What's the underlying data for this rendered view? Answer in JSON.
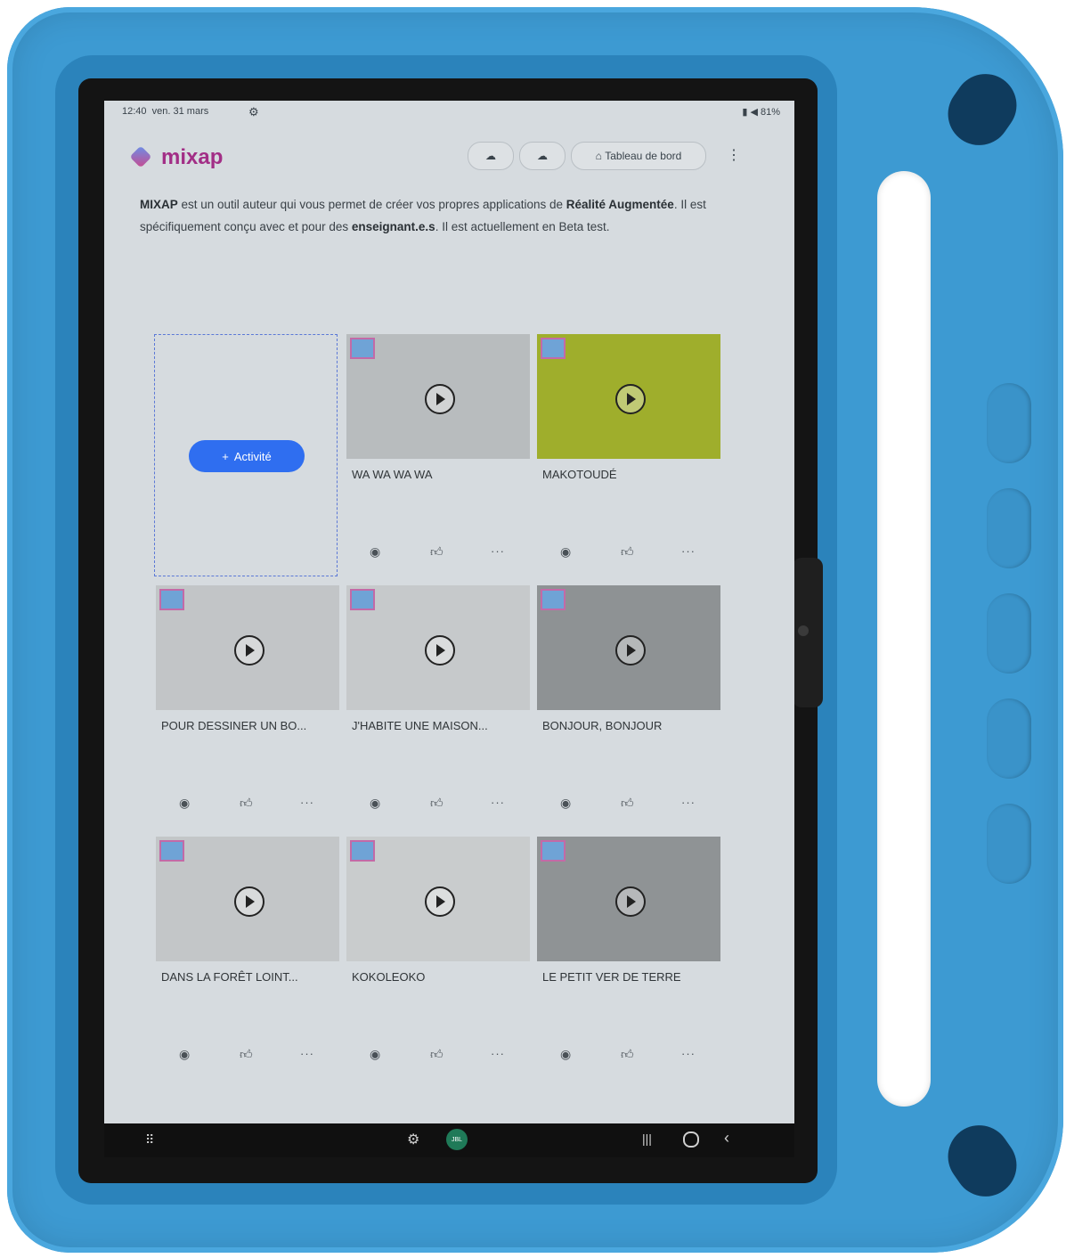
{
  "status": {
    "time": "12:40",
    "date": "ven. 31 mars",
    "battery": "81%"
  },
  "app": {
    "brand": "mixap",
    "dashboard_label": "Tableau de bord"
  },
  "intro": {
    "p1": "MIXAP",
    "p2": " est un outil auteur qui vous permet de créer vos propres applications de ",
    "p3": "Réalité Augmentée",
    "p4": ". Il est spécifiquement conçu avec et pour des ",
    "p5": "enseignant.e.s",
    "p6": ". Il est actuellement en Beta test."
  },
  "add_activity_label": "Activité",
  "activities": [
    {
      "title": "WA WA WA WA",
      "thumb_color": "#b8bcbe"
    },
    {
      "title": "MAKOTOUDÉ",
      "thumb_color": "#9fae2c"
    },
    {
      "title": "POUR DESSINER UN BO...",
      "thumb_color": "#c2c5c7"
    },
    {
      "title": "J'HABITE UNE MAISON...",
      "thumb_color": "#c6c9cb"
    },
    {
      "title": "BONJOUR, BONJOUR",
      "thumb_color": "#8e9294"
    },
    {
      "title": "DANS LA FORÊT LOINT...",
      "thumb_color": "#c3c6c8"
    },
    {
      "title": "KOKOLEOKO",
      "thumb_color": "#c9cccd"
    },
    {
      "title": "LE PETIT VER DE TERRE",
      "thumb_color": "#8f9395"
    }
  ],
  "icons": {
    "settings": "gear-icon",
    "download": "cloud-download-icon",
    "home": "home-icon",
    "more": "more-vert-icon",
    "view": "eye-icon",
    "like": "thumb-up-icon",
    "play": "play-icon"
  },
  "colors": {
    "brand": "#a22e86",
    "primary_button": "#2f6ef0",
    "case": "#3d9ad2"
  }
}
